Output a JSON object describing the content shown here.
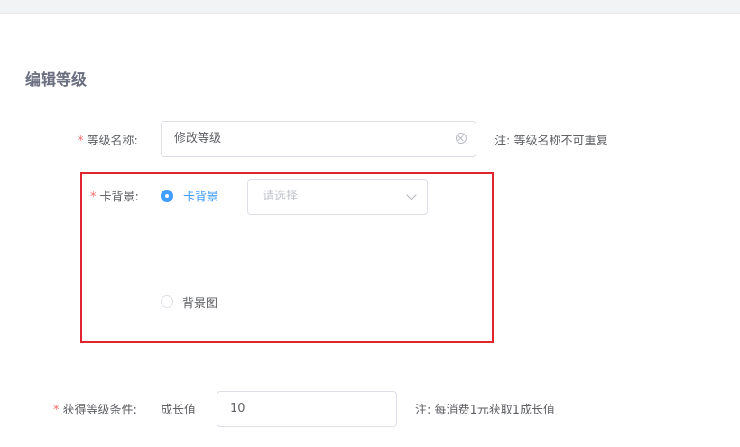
{
  "page": {
    "title": "编辑等级"
  },
  "level_name": {
    "required_mark": "*",
    "label": "等级名称:",
    "value": "修改等级",
    "note": "注: 等级名称不可重复"
  },
  "card_background": {
    "required_mark": "*",
    "label": "卡背景:",
    "options": [
      {
        "label": "卡背景",
        "checked": true
      },
      {
        "label": "背景图",
        "checked": false
      }
    ],
    "select_placeholder": "请选择"
  },
  "condition": {
    "required_mark": "*",
    "label": "获得等级条件:",
    "prefix": "成长值",
    "value": "10",
    "note": "注: 每消费1元获取1成长值"
  },
  "colors": {
    "accent": "#409eff",
    "required": "#f56c6c",
    "highlight_border": "#e0262c"
  }
}
